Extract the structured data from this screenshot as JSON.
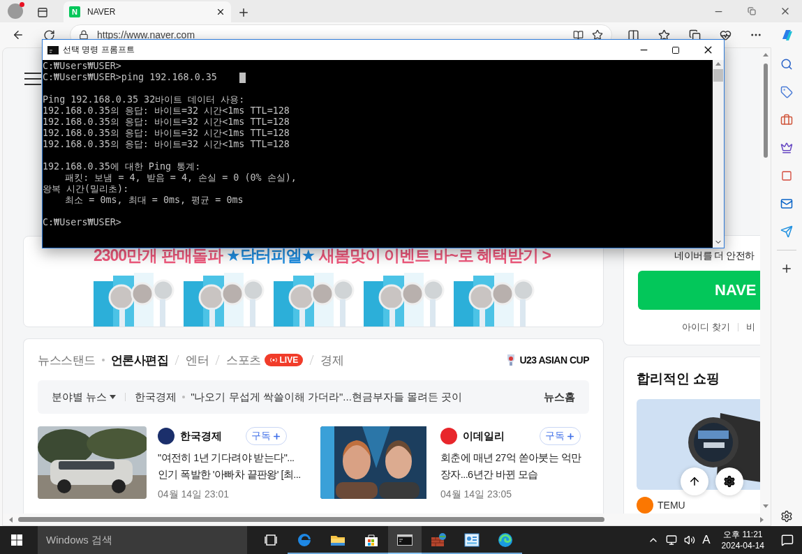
{
  "browser": {
    "tabs": [
      {
        "title": "NAVER",
        "icon_letter": "N",
        "selected": true
      }
    ],
    "address": "https://www.naver.com"
  },
  "page": {
    "banner": {
      "headline": [
        {
          "text": "2300만개 판매돌파 ",
          "color": "#f0587c"
        },
        {
          "text": "★닥터피엘★",
          "color": "#1f8de0"
        },
        {
          "text": " 새봄맞이 이벤트 바~로 혜택받기 >",
          "color": "#f0587c"
        }
      ]
    },
    "news": {
      "tabs": [
        {
          "label": "뉴스스탠드",
          "selected": false
        },
        {
          "label": "언론사편집",
          "selected": true
        },
        {
          "label": "엔터",
          "selected": false
        },
        {
          "label": "스포츠",
          "selected": false,
          "badge": "LIVE"
        },
        {
          "label": "경제",
          "selected": false
        }
      ],
      "event_logo": "U23 ASIAN CUP",
      "ticker": {
        "category": "분야별 뉴스",
        "press": "한국경제",
        "headline": "\"나오기 무섭게 싹쓸이해 가더라\"...현금부자들 몰려든 곳이",
        "home": "뉴스홈"
      },
      "articles": [
        {
          "kind": "car",
          "press": "한국경제",
          "color": "#1b2f6b",
          "subscribe": "구독",
          "lines": [
            "\"여전히 1년 기다려야 받는다\"...",
            "인기 폭발한 '아빠차 끝판왕' [최..."
          ],
          "time": "04월 14일 23:01"
        },
        {
          "kind": "people",
          "press": "이데일리",
          "color": "#e8262b",
          "subscribe": "구독",
          "lines": [
            "회춘에 매년 27억 쏟아붓는 억만",
            "장자...6년간 바뀐 모습"
          ],
          "time": "04월 14일 23:05"
        }
      ]
    },
    "login": {
      "notice": "네이버를 더 안전하",
      "button": "NAVE",
      "links": [
        "아이디 찾기",
        "비"
      ]
    },
    "shopping": {
      "title": "합리적인 쇼핑",
      "brand": "TEMU"
    }
  },
  "console": {
    "title": "선택 명령 프롬프트",
    "blocks": [
      [
        "C:₩Users₩USER>",
        "C:₩Users₩USER>ping 192.168.0.35"
      ],
      [
        "Ping 192.168.0.35 32바이트 데이터 사용:",
        "192.168.0.35의 응답: 바이트=32 시간<1ms TTL=128",
        "192.168.0.35의 응답: 바이트=32 시간<1ms TTL=128",
        "192.168.0.35의 응답: 바이트=32 시간<1ms TTL=128",
        "192.168.0.35의 응답: 바이트=32 시간<1ms TTL=128"
      ],
      [
        "192.168.0.35에 대한 Ping 통계:",
        "    패킷: 보냄 = 4, 받음 = 4, 손실 = 0 (0% 손실),",
        "왕복 시간(밀리초):",
        "    최소 = 0ms, 최대 = 0ms, 평균 = 0ms"
      ],
      [
        "C:₩Users₩USER>"
      ]
    ]
  },
  "taskbar": {
    "search_placeholder": "Windows 검색",
    "apps": [
      {
        "kind": "taskview",
        "selected": false
      },
      {
        "kind": "edge-legacy",
        "selected": false
      },
      {
        "kind": "explorer",
        "selected": false
      },
      {
        "kind": "store",
        "selected": false
      },
      {
        "kind": "terminal",
        "selected": true
      },
      {
        "kind": "firewall",
        "selected": false
      },
      {
        "kind": "panel",
        "selected": false
      },
      {
        "kind": "edge",
        "selected": false
      }
    ],
    "ime": "A",
    "time": "오후 11:21",
    "date": "2024-04-14"
  }
}
